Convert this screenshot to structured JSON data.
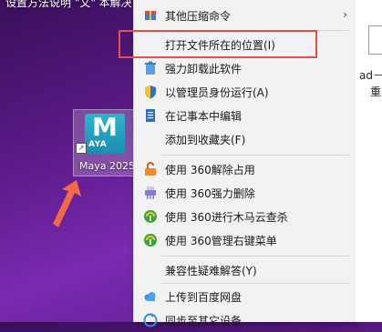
{
  "desktop": {
    "top_text": "设置方法说明 \"文\" 本解决",
    "icon_label": "Maya 2025",
    "app_tile_letter": "M",
    "app_tile_sub": "AYA"
  },
  "menu": {
    "items": [
      {
        "label": "其他压缩命令",
        "icon": "compress-icon",
        "has_submenu": true
      },
      {
        "label": "打开文件所在的位置(I)",
        "icon": "",
        "has_submenu": false
      },
      {
        "label": "强力卸载此软件",
        "icon": "trash-icon",
        "has_submenu": false
      },
      {
        "label": "以管理员身份运行(A)",
        "icon": "shield-icon",
        "has_submenu": false
      },
      {
        "label": "在记事本中编辑",
        "icon": "notepad-icon",
        "has_submenu": false
      },
      {
        "label": "添加到收藏夹(F)",
        "icon": "",
        "has_submenu": false
      },
      {
        "label": "使用 360解除占用",
        "icon": "unlock-icon",
        "has_submenu": false
      },
      {
        "label": "使用 360强力删除",
        "icon": "shredder-icon",
        "has_submenu": false
      },
      {
        "label": "使用 360进行木马云查杀",
        "icon": "360-scan-icon",
        "has_submenu": false
      },
      {
        "label": "使用 360管理右键菜单",
        "icon": "360-menu-icon",
        "has_submenu": false
      },
      {
        "label": "兼容性疑难解答(Y)",
        "icon": "",
        "has_submenu": false
      },
      {
        "label": "上传到百度网盘",
        "icon": "cloud-icon",
        "has_submenu": false
      },
      {
        "label": "同步至其它设备",
        "icon": "sync-icon",
        "has_submenu": false
      }
    ]
  },
  "right_panel": {
    "text1": "ad－",
    "text2": "重"
  },
  "colors": {
    "highlight": "#e64d4d",
    "arrow": "#f06a4a"
  }
}
